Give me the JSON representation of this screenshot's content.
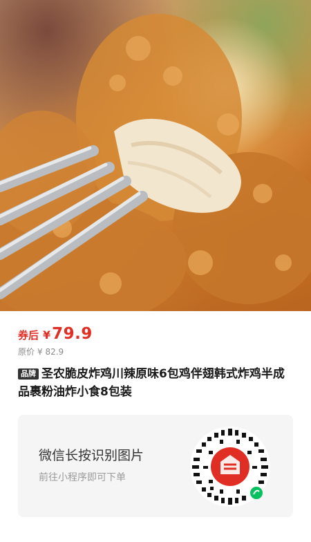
{
  "product": {
    "coupon_label": "券后",
    "currency": "¥",
    "price": "79.9",
    "original_label": "原价",
    "original_price": "¥ 82.9",
    "brand_tag": "品牌",
    "title": "圣农脆皮炸鸡川辣原味6包鸡伴翅韩式炸鸡半成品裹粉油炸小食8包装"
  },
  "qr_card": {
    "title": "微信长按识别图片",
    "subtitle": "前往小程序即可下单"
  },
  "colors": {
    "accent": "#e02e24",
    "card_bg": "#f5f5f5",
    "brand_tag_bg": "#333333"
  }
}
